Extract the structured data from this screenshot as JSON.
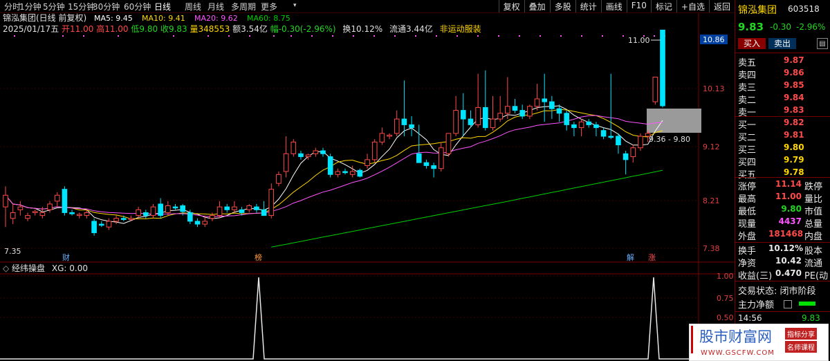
{
  "toolbar": {
    "periods": [
      "分时",
      "1分钟",
      "5分钟",
      "15分钟",
      "30分钟",
      "60分钟",
      "日线",
      "周线",
      "月线",
      "多周期",
      "更多"
    ],
    "active_period": "日线",
    "right_buttons": [
      "复权",
      "叠加",
      "多股",
      "统计",
      "画线",
      "F10",
      "标记",
      "+自选",
      "返回"
    ]
  },
  "main_chart": {
    "title": "锦泓集团(日线 前复权)",
    "ma_labels": [
      {
        "text": "MA5: 9.45",
        "color": "#ffffff"
      },
      {
        "text": "MA10: 9.41",
        "color": "#ffd700"
      },
      {
        "text": "MA20: 9.62",
        "color": "#ff55ff"
      },
      {
        "text": "MA60: 8.75",
        "color": "#00d000"
      }
    ],
    "date": "2025/01/17五",
    "open_label": "开11.00",
    "high_label": "高11.00",
    "low_label": "低9.80",
    "close_label": "收9.83",
    "volume_label": "量348553",
    "amount_label": "额3.54亿",
    "change_label": "幅-0.30(-2.96%)",
    "turnover_label": "换10.12%",
    "float_label": "流通3.44亿",
    "concept_label": "非运动服装",
    "y_ticks": [
      "10.86",
      "10.13",
      "9.12",
      "8.21",
      "7.38"
    ],
    "high_marker": "11.00",
    "low_marker": "7.35",
    "range_marker": "9.36 - 9.80",
    "event_markers": [
      {
        "text": "财",
        "color": "#6ab0ff"
      },
      {
        "text": "榜",
        "color": "#ff9a3a"
      },
      {
        "text": "解",
        "color": "#6ab0ff"
      },
      {
        "text": "涨",
        "color": "#ff5050"
      }
    ]
  },
  "indicator": {
    "name": "经纬操盘",
    "value_label": "XG: 0.00",
    "y_ticks": [
      "1.00",
      "0.75",
      "0.50"
    ]
  },
  "chart_data": {
    "type": "candlestick",
    "candles": [
      [
        8.1,
        8.3,
        7.75,
        8.45
      ],
      [
        7.9,
        8.0,
        7.8,
        8.15
      ],
      [
        8.05,
        8.1,
        7.95,
        8.2
      ],
      [
        7.9,
        7.95,
        7.85,
        8.0
      ],
      [
        8.0,
        8.02,
        7.95,
        8.05
      ],
      [
        7.95,
        8.0,
        7.9,
        8.1
      ],
      [
        8.05,
        8.15,
        8.0,
        8.2
      ],
      [
        8.2,
        8.3,
        8.1,
        8.35
      ],
      [
        8.4,
        8.0,
        7.95,
        8.45
      ],
      [
        8.0,
        7.98,
        7.95,
        8.05
      ],
      [
        7.95,
        7.97,
        7.9,
        8.0
      ],
      [
        7.95,
        8.0,
        7.9,
        8.05
      ],
      [
        7.85,
        7.65,
        7.6,
        7.9
      ],
      [
        7.8,
        7.78,
        7.75,
        7.85
      ],
      [
        7.75,
        7.85,
        7.7,
        7.9
      ],
      [
        7.85,
        7.9,
        7.8,
        7.95
      ],
      [
        7.9,
        7.88,
        7.85,
        7.95
      ],
      [
        7.88,
        7.9,
        7.85,
        7.95
      ],
      [
        7.95,
        8.05,
        7.9,
        8.1
      ],
      [
        8.0,
        7.95,
        7.9,
        8.05
      ],
      [
        7.95,
        8.1,
        7.9,
        8.15
      ],
      [
        8.15,
        7.95,
        7.9,
        8.25
      ],
      [
        8.0,
        8.12,
        7.95,
        8.2
      ],
      [
        8.1,
        8.08,
        8.05,
        8.15
      ],
      [
        8.12,
        8.02,
        7.95,
        8.15
      ],
      [
        8.0,
        7.85,
        7.8,
        8.05
      ],
      [
        7.85,
        7.8,
        7.75,
        7.9
      ],
      [
        7.8,
        7.85,
        7.75,
        7.95
      ],
      [
        7.9,
        7.95,
        7.85,
        8.0
      ],
      [
        7.95,
        8.1,
        7.9,
        8.2
      ],
      [
        8.1,
        8.05,
        8.0,
        8.15
      ],
      [
        8.05,
        8.1,
        8.0,
        8.2
      ],
      [
        8.05,
        8.0,
        7.95,
        8.1
      ],
      [
        8.05,
        8.12,
        8.0,
        8.15
      ],
      [
        8.1,
        8.05,
        8.0,
        8.15
      ],
      [
        8.05,
        7.95,
        7.95,
        8.2
      ],
      [
        7.95,
        8.4,
        7.9,
        8.5
      ],
      [
        8.5,
        8.65,
        8.45,
        8.7
      ],
      [
        8.7,
        9.0,
        8.6,
        9.3
      ],
      [
        9.0,
        9.2,
        8.95,
        9.25
      ],
      [
        9.0,
        8.95,
        8.9,
        9.05
      ],
      [
        8.95,
        8.98,
        8.9,
        9.0
      ],
      [
        9.0,
        9.05,
        8.95,
        9.1
      ],
      [
        9.05,
        9.0,
        8.95,
        9.1
      ],
      [
        8.95,
        8.65,
        8.6,
        9.0
      ],
      [
        8.65,
        8.7,
        8.6,
        8.75
      ],
      [
        8.7,
        8.68,
        8.65,
        8.75
      ],
      [
        8.65,
        8.7,
        8.6,
        8.8
      ],
      [
        8.72,
        8.62,
        8.6,
        8.75
      ],
      [
        8.8,
        8.9,
        8.75,
        9.0
      ],
      [
        8.9,
        9.2,
        8.85,
        9.25
      ],
      [
        9.2,
        9.35,
        9.15,
        9.45
      ],
      [
        9.3,
        9.32,
        9.25,
        9.35
      ],
      [
        9.35,
        9.6,
        9.3,
        9.75
      ],
      [
        9.6,
        9.5,
        9.3,
        10.25
      ],
      [
        9.5,
        9.45,
        9.3,
        9.65
      ],
      [
        9.0,
        8.85,
        8.85,
        9.5
      ],
      [
        8.85,
        8.8,
        8.75,
        8.9
      ],
      [
        8.8,
        8.75,
        8.6,
        8.85
      ],
      [
        8.75,
        9.1,
        8.7,
        9.2
      ],
      [
        9.0,
        9.35,
        8.95,
        9.35
      ],
      [
        9.35,
        9.75,
        9.3,
        10.0
      ],
      [
        9.75,
        9.6,
        9.3,
        10.05
      ],
      [
        9.6,
        9.5,
        9.45,
        9.75
      ],
      [
        9.5,
        9.8,
        9.45,
        10.35
      ],
      [
        9.8,
        9.45,
        9.4,
        10.4
      ],
      [
        9.45,
        9.6,
        9.4,
        10.0
      ],
      [
        9.6,
        9.7,
        9.55,
        10.0
      ],
      [
        9.7,
        9.82,
        9.6,
        10.3
      ],
      [
        9.82,
        9.75,
        9.7,
        9.95
      ],
      [
        9.75,
        9.65,
        9.6,
        9.85
      ],
      [
        9.65,
        9.82,
        9.6,
        9.85
      ],
      [
        9.82,
        9.95,
        9.75,
        10.2
      ],
      [
        9.95,
        9.9,
        9.55,
        10.35
      ],
      [
        9.9,
        9.78,
        9.6,
        10.0
      ],
      [
        9.78,
        9.7,
        9.55,
        9.85
      ],
      [
        9.7,
        9.5,
        9.4,
        9.75
      ],
      [
        9.5,
        9.45,
        9.3,
        9.55
      ],
      [
        9.45,
        9.55,
        9.3,
        9.6
      ],
      [
        9.55,
        9.5,
        9.45,
        9.6
      ],
      [
        9.5,
        9.45,
        9.3,
        9.55
      ],
      [
        9.4,
        9.3,
        9.25,
        9.45
      ],
      [
        9.3,
        9.28,
        9.25,
        10.35
      ],
      [
        9.3,
        9.15,
        9.0,
        9.35
      ],
      [
        9.0,
        8.9,
        8.65,
        9.05
      ],
      [
        8.95,
        9.1,
        8.85,
        9.15
      ],
      [
        9.1,
        9.3,
        9.05,
        9.35
      ],
      [
        9.3,
        9.35,
        9.2,
        9.4
      ],
      [
        9.9,
        10.3,
        9.85,
        10.3
      ],
      [
        11.0,
        9.83,
        9.8,
        11.0
      ]
    ],
    "ma5_color": "#ffffff",
    "ma10_color": "#ffd700",
    "ma20_color": "#ff55ff",
    "ma60_color": "#00d000",
    "up_color": "#ff4a4a",
    "down_color": "#00e5ff"
  },
  "quote": {
    "name": "锦泓集团",
    "code": "603518",
    "price": "9.83",
    "change": "-0.30",
    "change_pct": "-2.96%",
    "buy_button": "买入",
    "sell_button": "卖出",
    "sells": [
      {
        "label": "卖五",
        "price": "9.87"
      },
      {
        "label": "卖四",
        "price": "9.86"
      },
      {
        "label": "卖三",
        "price": "9.85"
      },
      {
        "label": "卖二",
        "price": "9.84"
      },
      {
        "label": "卖一",
        "price": "9.83"
      }
    ],
    "buys": [
      {
        "label": "买一",
        "price": "9.82"
      },
      {
        "label": "买二",
        "price": "9.81"
      },
      {
        "label": "买三",
        "price": "9.80"
      },
      {
        "label": "买四",
        "price": "9.79"
      },
      {
        "label": "买五",
        "price": "9.78"
      }
    ],
    "stats": [
      {
        "label": "涨停",
        "value": "11.14",
        "extra": "跌停",
        "color": "#ff4a4a"
      },
      {
        "label": "最高",
        "value": "11.00",
        "extra": "量比",
        "color": "#ff4a4a"
      },
      {
        "label": "最低",
        "value": "9.80",
        "extra": "市值",
        "color": "#23d623"
      },
      {
        "label": "现量",
        "value": "4437",
        "extra": "总量",
        "color": "#ff55ff"
      },
      {
        "label": "外盘",
        "value": "181468",
        "extra": "内盘",
        "color": "#ff4a4a"
      }
    ],
    "stats2": [
      {
        "label": "换手",
        "value": "10.12%",
        "extra": "股本"
      },
      {
        "label": "净资",
        "value": "10.42",
        "extra": "流通"
      },
      {
        "label": "收益(三)",
        "value": "0.470",
        "extra": "PE(动"
      }
    ],
    "trade_status": "交易状态: 闭市阶段",
    "main_net": "主力净额",
    "tick_time": "14:56",
    "tick_price": "9.83"
  },
  "watermark": {
    "title": "股市财富网",
    "tag1": "指标分享",
    "tag2": "名师课程",
    "url": "WWW.GSCFW.COM"
  }
}
